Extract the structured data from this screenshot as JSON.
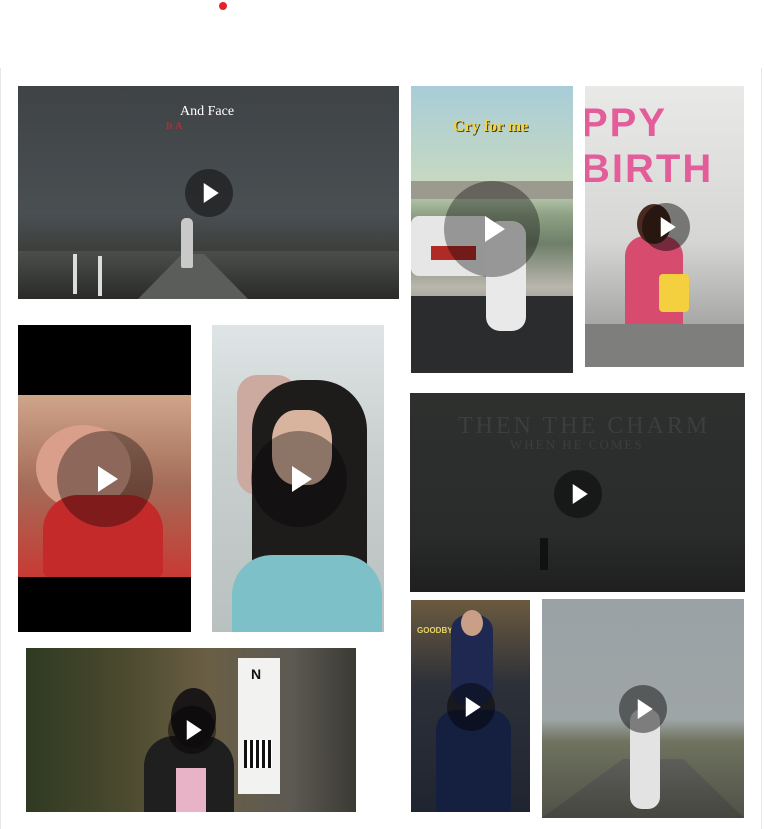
{
  "page": {
    "indicator_color": "#e3222b"
  },
  "tiles": [
    {
      "id": "storm-road",
      "overlay": "And Face",
      "overlay_sub": "It A"
    },
    {
      "id": "cry-for-me-bike",
      "overlay": "Cry for me"
    },
    {
      "id": "birthday-cake",
      "overlay": "PPY BIRTH"
    },
    {
      "id": "baby-red-dress"
    },
    {
      "id": "girl-hair"
    },
    {
      "id": "field-night",
      "overlay": "THEN THE CHARM",
      "overlay_sub": "WHEN HE COMES"
    },
    {
      "id": "friends-celebration",
      "overlay": "GOODBYES"
    },
    {
      "id": "girl-jacket-cafe",
      "overlay": "N"
    },
    {
      "id": "man-walking-road"
    }
  ],
  "icons": {
    "play": "play-icon"
  }
}
